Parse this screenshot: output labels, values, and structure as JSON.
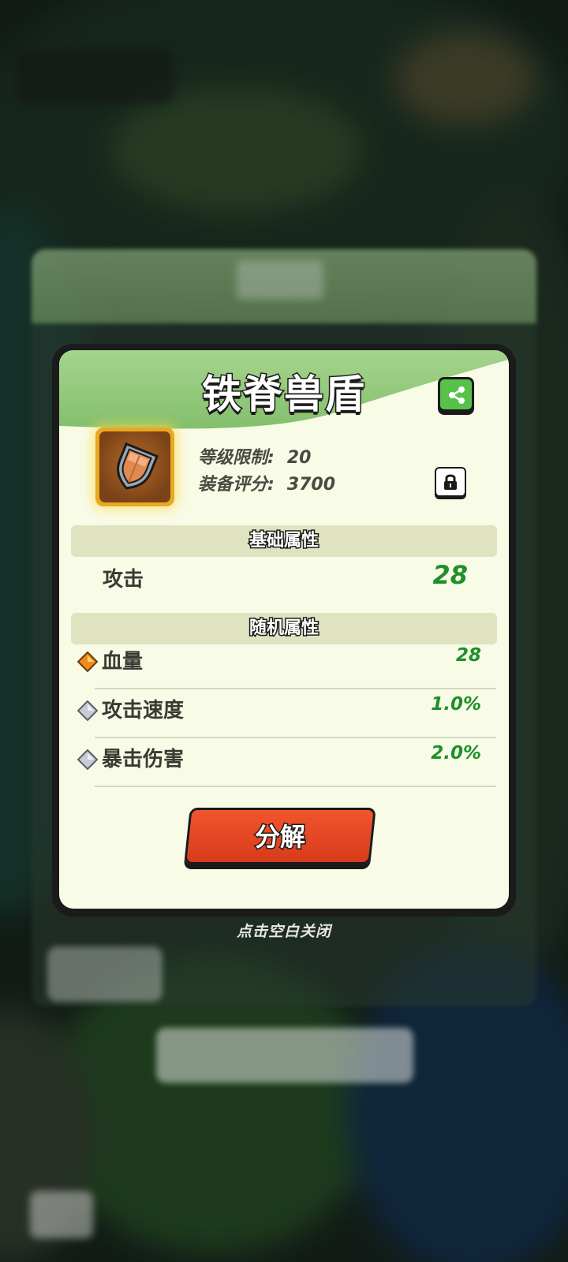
{
  "item": {
    "name": "铁脊兽盾",
    "icon": "shield-icon"
  },
  "meta": {
    "level_label": "等级限制:",
    "level_value": "20",
    "score_label": "装备评分:",
    "score_value": "3700"
  },
  "sections": {
    "base_title": "基础属性",
    "random_title": "随机属性"
  },
  "base_attributes": [
    {
      "label": "攻击",
      "value": "28"
    }
  ],
  "random_attributes": [
    {
      "label": "血量",
      "value": "28",
      "gem": "orange-gem-icon",
      "gem_color": "#f08a1c"
    },
    {
      "label": "攻击速度",
      "value": "1.0%",
      "gem": "silver-gem-icon",
      "gem_color": "#c7cdd6"
    },
    {
      "label": "暴击伤害",
      "value": "2.0%",
      "gem": "silver-gem-icon",
      "gem_color": "#c7cdd6"
    }
  ],
  "actions": {
    "decompose_label": "分解",
    "share_icon": "share-icon",
    "lock_icon": "lock-icon"
  },
  "hint": "点击空白关闭",
  "colors": {
    "header_green": "#8cc575",
    "panel_bg": "#f8fbe6",
    "value_green": "#1f8f2a",
    "button_red": "#e4461f",
    "frame_gold": "#e8a822"
  }
}
